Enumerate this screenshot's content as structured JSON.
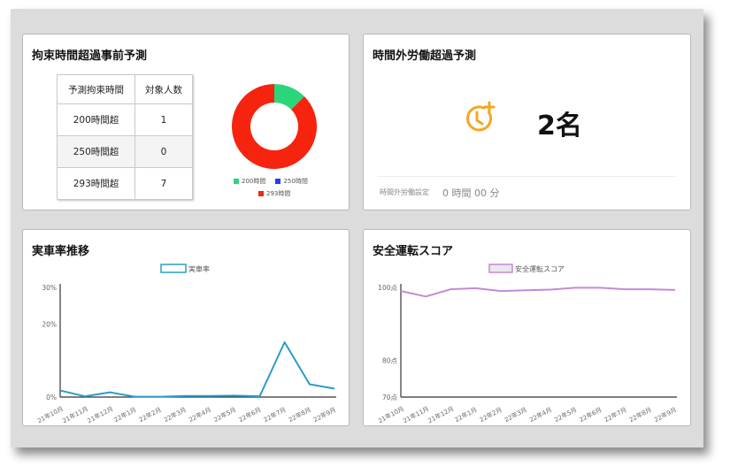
{
  "prediction_card": {
    "title": "拘束時間超過事前予測",
    "table_headers": [
      "予測拘束時間",
      "対象人数"
    ],
    "rows": [
      {
        "label": "200時間超",
        "count": "1"
      },
      {
        "label": "250時間超",
        "count": "0"
      },
      {
        "label": "293時間超",
        "count": "7"
      }
    ],
    "legend": [
      {
        "label": "200時間",
        "color": "#2bd67b"
      },
      {
        "label": "250時間",
        "color": "#1f3cff"
      },
      {
        "label": "293時間",
        "color": "#f6230f"
      }
    ]
  },
  "overtime_card": {
    "title": "時間外労働超過予測",
    "icon": "clock-plus-icon",
    "icon_color": "#f5a623",
    "value": "2名",
    "setting_label": "時間外労働設定",
    "setting_value": "0 時間 00 分"
  },
  "utilization_card": {
    "title": "実車率推移",
    "legend": "実車率"
  },
  "safety_card": {
    "title": "安全運転スコア",
    "legend": "安全運転スコア"
  },
  "chart_data": [
    {
      "type": "pie",
      "labels": [
        "200時間",
        "250時間",
        "293時間"
      ],
      "values": [
        1,
        0,
        7
      ],
      "colors": [
        "#2bd67b",
        "#1f3cff",
        "#f6230f"
      ],
      "donut": true
    },
    {
      "type": "line",
      "series": [
        {
          "name": "実車率",
          "values": [
            1.8,
            0.2,
            1.3,
            0.1,
            0.1,
            0.3,
            0.3,
            0.4,
            0.2,
            15.0,
            3.5,
            2.3
          ],
          "color": "#2a9dc8"
        }
      ],
      "categories": [
        "21年10月",
        "21年11月",
        "21年12月",
        "22年1月",
        "22年2月",
        "22年3月",
        "22年4月",
        "22年5月",
        "22年6月",
        "22年7月",
        "22年8月",
        "22年9月"
      ],
      "yticks": [
        "0%",
        "20%",
        "30%"
      ],
      "ylim": [
        0,
        30
      ]
    },
    {
      "type": "line",
      "series": [
        {
          "name": "安全運転スコア",
          "values": [
            99.0,
            97.5,
            99.5,
            99.8,
            99.0,
            99.2,
            99.4,
            99.9,
            99.9,
            99.5,
            99.5,
            99.3
          ],
          "color": "#c48ad6"
        }
      ],
      "categories": [
        "21年10月",
        "21年11月",
        "21年12月",
        "22年1月",
        "22年2月",
        "22年3月",
        "22年4月",
        "22年5月",
        "22年6月",
        "22年7月",
        "22年8月",
        "22年9月"
      ],
      "yticks": [
        "70点",
        "80点",
        "100点"
      ],
      "ylim": [
        70,
        100
      ]
    }
  ]
}
